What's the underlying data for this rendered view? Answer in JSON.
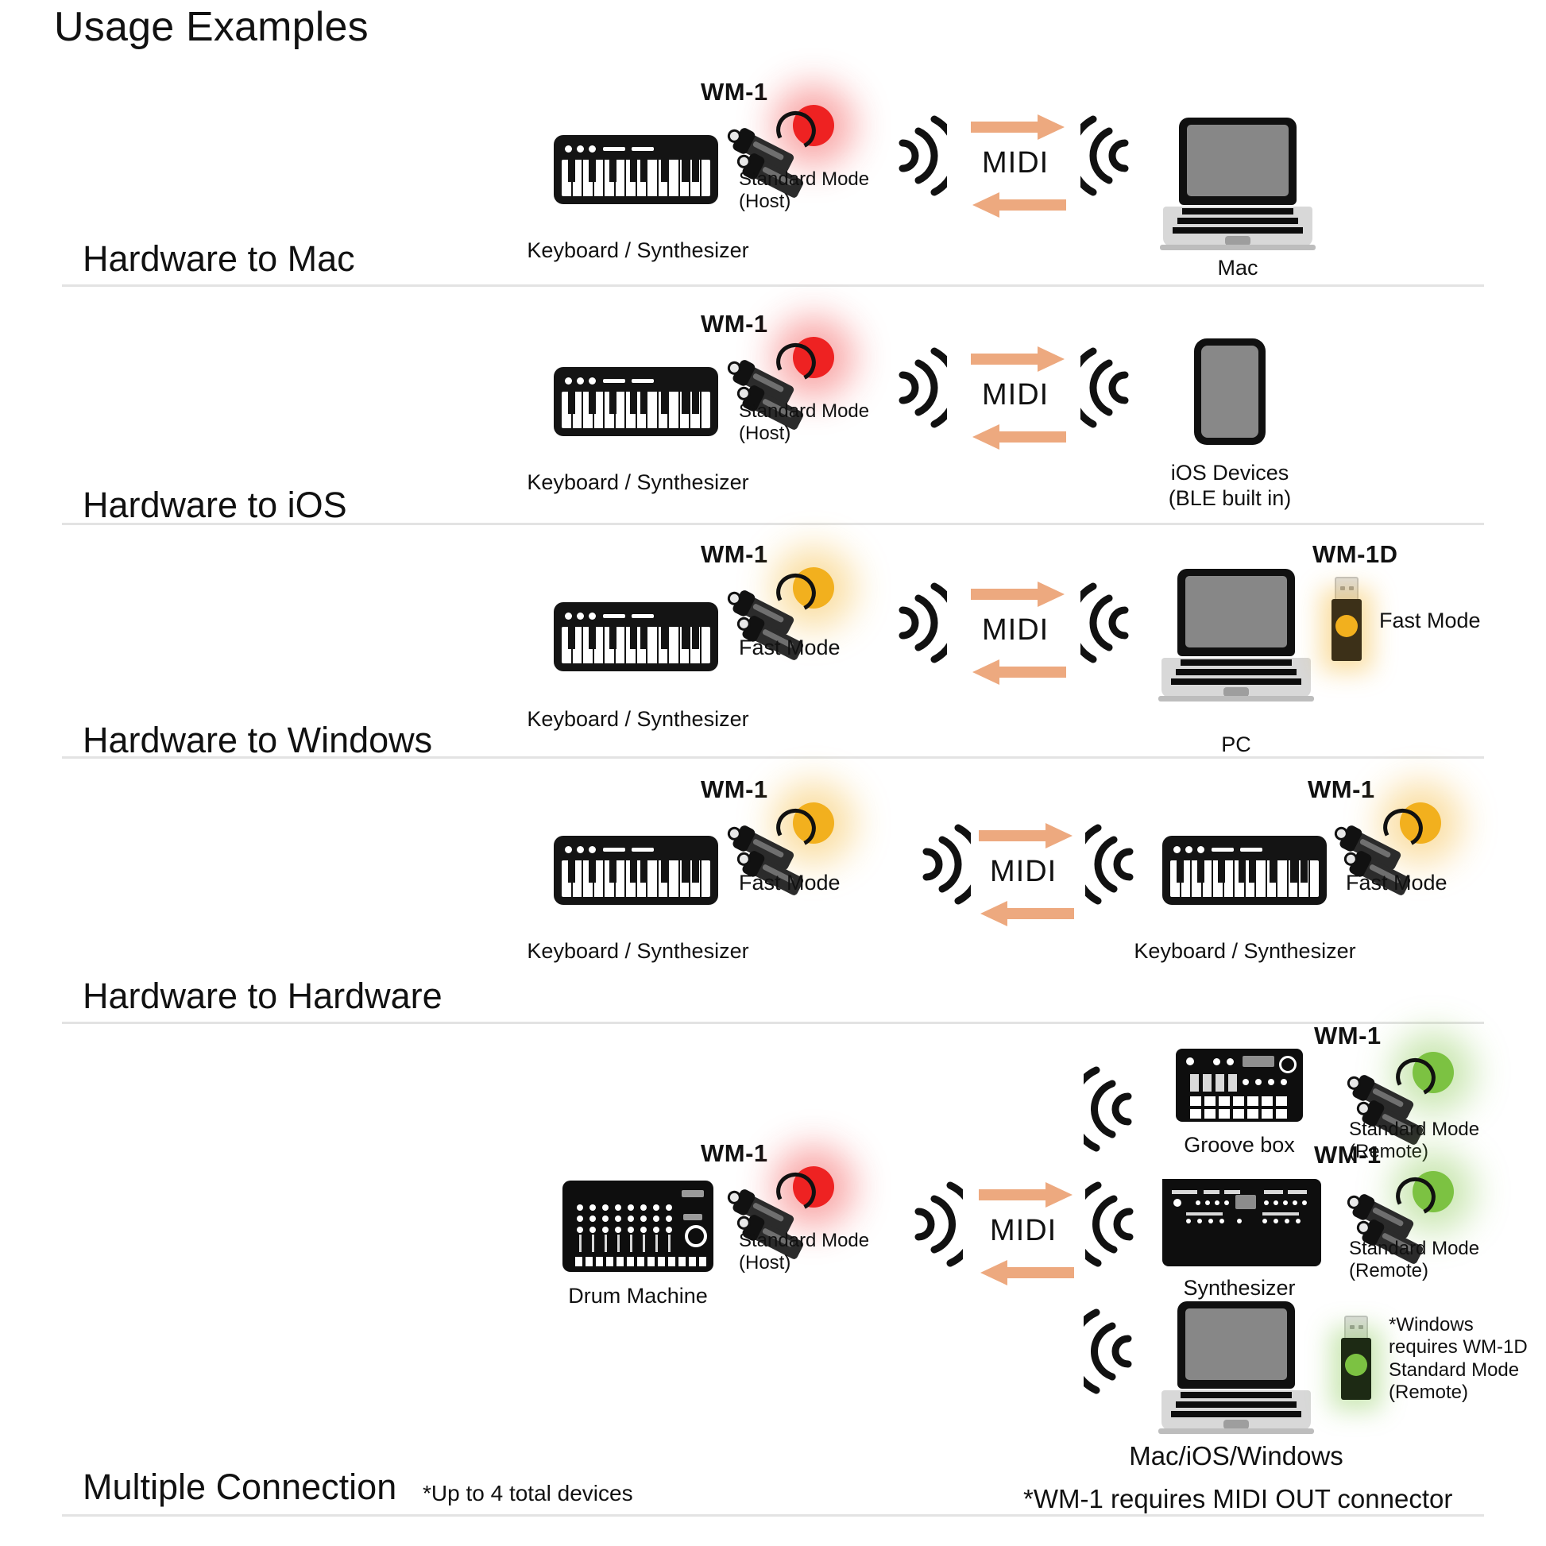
{
  "title": "Usage Examples",
  "colors": {
    "led_red": "#ee2222",
    "led_amber": "#f2b01e",
    "led_green": "#7cc242",
    "arrow": "#eda97f",
    "divider": "#e3e3e3",
    "screen_gray": "#878787"
  },
  "labels": {
    "wm1": "WM-1",
    "wm1d": "WM-1D",
    "midi": "MIDI",
    "standard_mode_host": "Standard Mode\n(Host)",
    "standard_mode_remote": "Standard Mode\n(Remote)",
    "fast_mode": "Fast Mode",
    "keyboard_synth": "Keyboard / Synthesizer",
    "mac": "Mac",
    "ios_devices": "iOS Devices\n(BLE built in)",
    "pc": "PC",
    "groove_box": "Groove box",
    "drum_machine": "Drum  Machine",
    "synthesizer": "Synthesizer",
    "mac_ios_windows": "Mac/iOS/Windows",
    "windows_note": "*Windows\nrequires WM-1D\nStandard Mode\n(Remote)"
  },
  "rows": [
    {
      "id": "hardware-to-mac",
      "label": "Hardware to Mac",
      "source_device": "Keyboard / Synthesizer",
      "source_dongle": "WM-1",
      "source_mode": "Standard Mode\n(Host)",
      "source_led": "red",
      "link": "MIDI",
      "target_device": "Mac",
      "target_dongle": null,
      "target_mode": null
    },
    {
      "id": "hardware-to-ios",
      "label": "Hardware to iOS",
      "source_device": "Keyboard / Synthesizer",
      "source_dongle": "WM-1",
      "source_mode": "Standard Mode\n(Host)",
      "source_led": "red",
      "link": "MIDI",
      "target_device": "iOS Devices\n(BLE built in)",
      "target_dongle": null,
      "target_mode": null
    },
    {
      "id": "hardware-to-windows",
      "label": "Hardware to Windows",
      "source_device": "Keyboard / Synthesizer",
      "source_dongle": "WM-1",
      "source_mode": "Fast Mode",
      "source_led": "amber",
      "link": "MIDI",
      "target_device": "PC",
      "target_dongle": "WM-1D",
      "target_mode": "Fast Mode",
      "target_led": "amber"
    },
    {
      "id": "hardware-to-hardware",
      "label": "Hardware to Hardware",
      "source_device": "Keyboard / Synthesizer",
      "source_dongle": "WM-1",
      "source_mode": "Fast Mode",
      "source_led": "amber",
      "link": "MIDI",
      "target_device": "Keyboard / Synthesizer",
      "target_dongle": "WM-1",
      "target_mode": "Fast Mode",
      "target_led": "amber"
    },
    {
      "id": "multiple-connection",
      "label": "Multiple Connection",
      "note": "*Up to 4 total devices",
      "source_device": "Drum  Machine",
      "source_dongle": "WM-1",
      "source_mode": "Standard Mode\n(Host)",
      "source_led": "red",
      "link": "MIDI",
      "targets": [
        {
          "device": "Groove box",
          "dongle": "WM-1",
          "mode": "Standard Mode\n(Remote)",
          "led": "green"
        },
        {
          "device": "Synthesizer",
          "dongle": "WM-1",
          "mode": "Standard Mode\n(Remote)",
          "led": "green"
        },
        {
          "device": "Mac/iOS/Windows",
          "dongle": null,
          "mode": "*Windows\nrequires WM-1D\nStandard Mode\n(Remote)",
          "led": "green"
        }
      ]
    }
  ],
  "footer": {
    "note": "*WM-1 requires MIDI OUT connector"
  }
}
